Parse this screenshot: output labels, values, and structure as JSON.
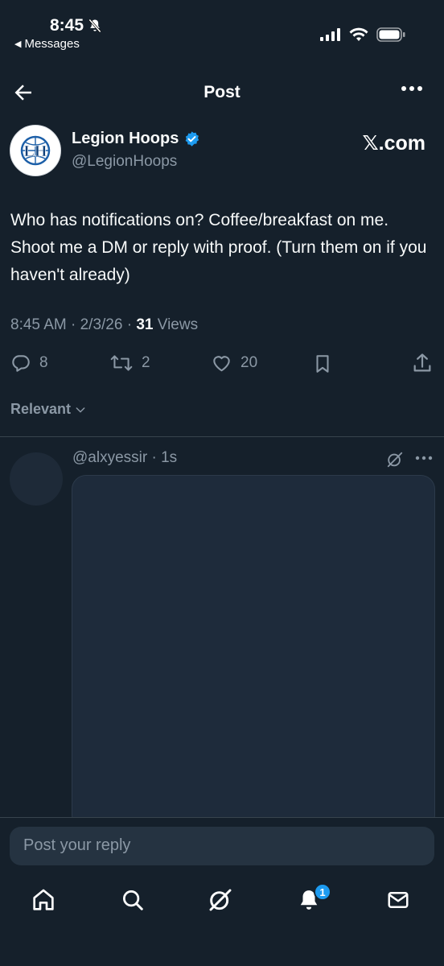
{
  "status_bar": {
    "time": "8:45",
    "back_label": "Messages"
  },
  "header": {
    "title": "Post"
  },
  "author": {
    "name": "Legion Hoops",
    "handle": "@LegionHoops",
    "site_label": "𝕏.com",
    "avatar_initials": "LH"
  },
  "post": {
    "text": "Who has notifications on? Coffee/breakfast on me. Shoot me a DM or reply with proof. (Turn them on if you haven't already)",
    "time": "8:45 AM",
    "date": "2/3/26",
    "views_count": "31",
    "views_label": "Views"
  },
  "actions": {
    "replies": "8",
    "reposts": "2",
    "likes": "20"
  },
  "sort": {
    "label": "Relevant"
  },
  "reply": {
    "handle": "@alxyessir",
    "time": "1s"
  },
  "composer": {
    "placeholder": "Post your reply"
  },
  "nav": {
    "notifications_badge": "1"
  },
  "colors": {
    "background": "#15202b",
    "accent": "#1d9bf0",
    "muted": "#8b98a5"
  }
}
